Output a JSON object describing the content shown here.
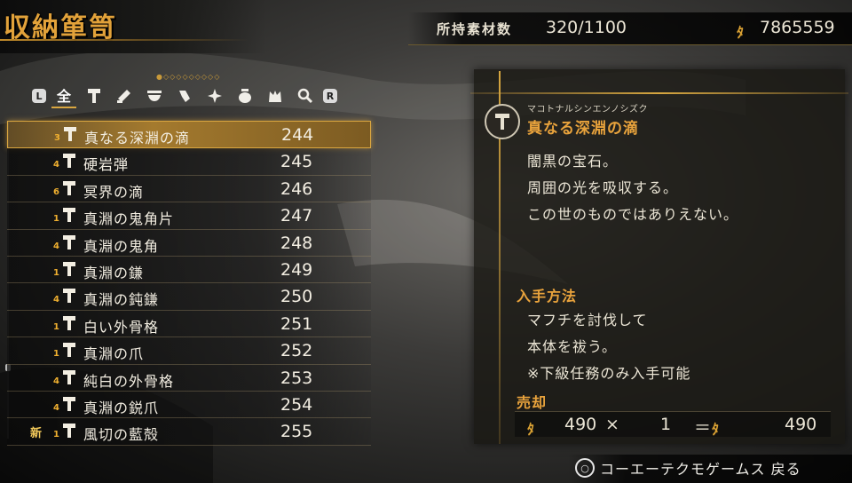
{
  "header": {
    "title": "収納箪笥",
    "materials_label": "所持素材数",
    "materials_count": "320/1100",
    "money": "7865559",
    "coin_icon": "amrita-coin-icon"
  },
  "tabs": {
    "left_button": "L",
    "right_button": "R",
    "page_dots": "●◇◇◇◇◇◇◇◇◇",
    "items": [
      {
        "label": "全",
        "icon": "all-icon"
      },
      {
        "label": "",
        "icon": "hammer-icon"
      },
      {
        "label": "",
        "icon": "forge-tools-icon"
      },
      {
        "label": "",
        "icon": "bowl-icon"
      },
      {
        "label": "",
        "icon": "tassel-icon"
      },
      {
        "label": "",
        "icon": "sparkle-icon"
      },
      {
        "label": "",
        "icon": "pot-icon"
      },
      {
        "label": "",
        "icon": "pouch-icon"
      },
      {
        "label": "",
        "icon": "magnifier-icon"
      }
    ]
  },
  "list": [
    {
      "new": "",
      "rarity": "3",
      "name": "真なる深淵の滴",
      "id": "244"
    },
    {
      "new": "",
      "rarity": "4",
      "name": "硬岩弾",
      "id": "245"
    },
    {
      "new": "",
      "rarity": "6",
      "name": "冥界の滴",
      "id": "246"
    },
    {
      "new": "",
      "rarity": "1",
      "name": "真淵の鬼角片",
      "id": "247"
    },
    {
      "new": "",
      "rarity": "4",
      "name": "真淵の鬼角",
      "id": "248"
    },
    {
      "new": "",
      "rarity": "1",
      "name": "真淵の鎌",
      "id": "249"
    },
    {
      "new": "",
      "rarity": "4",
      "name": "真淵の鈍鎌",
      "id": "250"
    },
    {
      "new": "",
      "rarity": "1",
      "name": "白い外骨格",
      "id": "251"
    },
    {
      "new": "",
      "rarity": "1",
      "name": "真淵の爪",
      "id": "252"
    },
    {
      "new": "",
      "rarity": "4",
      "name": "純白の外骨格",
      "id": "253"
    },
    {
      "new": "",
      "rarity": "4",
      "name": "真淵の鋭爪",
      "id": "254"
    },
    {
      "new": "新",
      "rarity": "1",
      "name": "風切の藍殻",
      "id": "255"
    }
  ],
  "detail": {
    "reading": "マコトナルシンエンノシズク",
    "name": "真なる深淵の滴",
    "description": [
      "闇黒の宝石。",
      "周囲の光を吸収する。",
      "この世のものではありえない。"
    ],
    "obtain_title": "入手方法",
    "obtain": [
      "マフチを討伐して",
      "本体を祓う。",
      "※下級任務のみ入手可能"
    ],
    "sell_title": "売却",
    "sell_price": "490",
    "sell_times": "×",
    "sell_qty": "1",
    "sell_equals": "＝",
    "sell_total": "490"
  },
  "footer": {
    "circle_button": "○",
    "back_label": "コーエーテクモゲームス 戻る"
  },
  "colors": {
    "accent": "#e9a33c",
    "selected_row": "#a47a2e"
  }
}
